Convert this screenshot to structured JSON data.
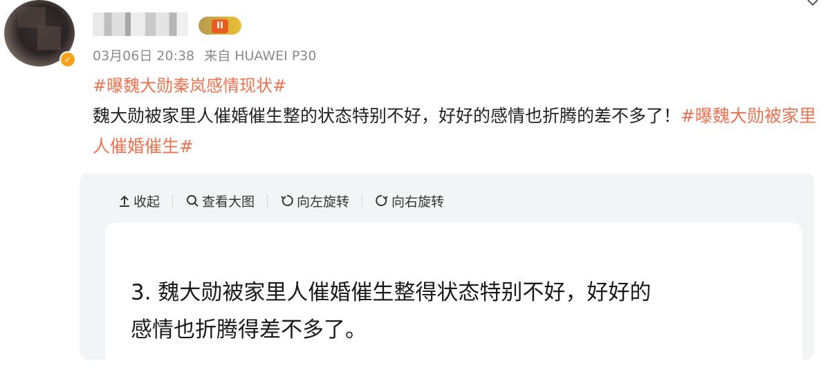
{
  "post": {
    "timestamp": "03月06日 20:38",
    "source": "来自 HUAWEI P30",
    "level_badge": "II",
    "topic": "#曝魏大勋秦岚感情现状#",
    "text_main": "魏大勋被家里人催婚催生整的状态特别不好，好好的感情也折腾的差不多了！",
    "text_tag": "#曝魏大勋被家里人催婚催生#"
  },
  "toolbar": {
    "collapse_label": "收起",
    "view_large_label": "查看大图",
    "rotate_left_label": "向左旋转",
    "rotate_right_label": "向右旋转"
  },
  "image": {
    "text": "3. 魏大勋被家里人催婚催生整得状态特别不好，好好的感情也折腾得差不多了。"
  },
  "icons": {
    "verify": "verified-badge-icon",
    "chevron": "chevron-down-icon",
    "collapse": "arrow-up-icon",
    "search": "search-icon",
    "rotate_left": "rotate-left-icon",
    "rotate_right": "rotate-right-icon"
  },
  "colors": {
    "accent": "#eb7350",
    "meta_gray": "#8a8a8a",
    "panel_bg": "#f3f4f6",
    "verify_badge": "#f7a21b"
  }
}
